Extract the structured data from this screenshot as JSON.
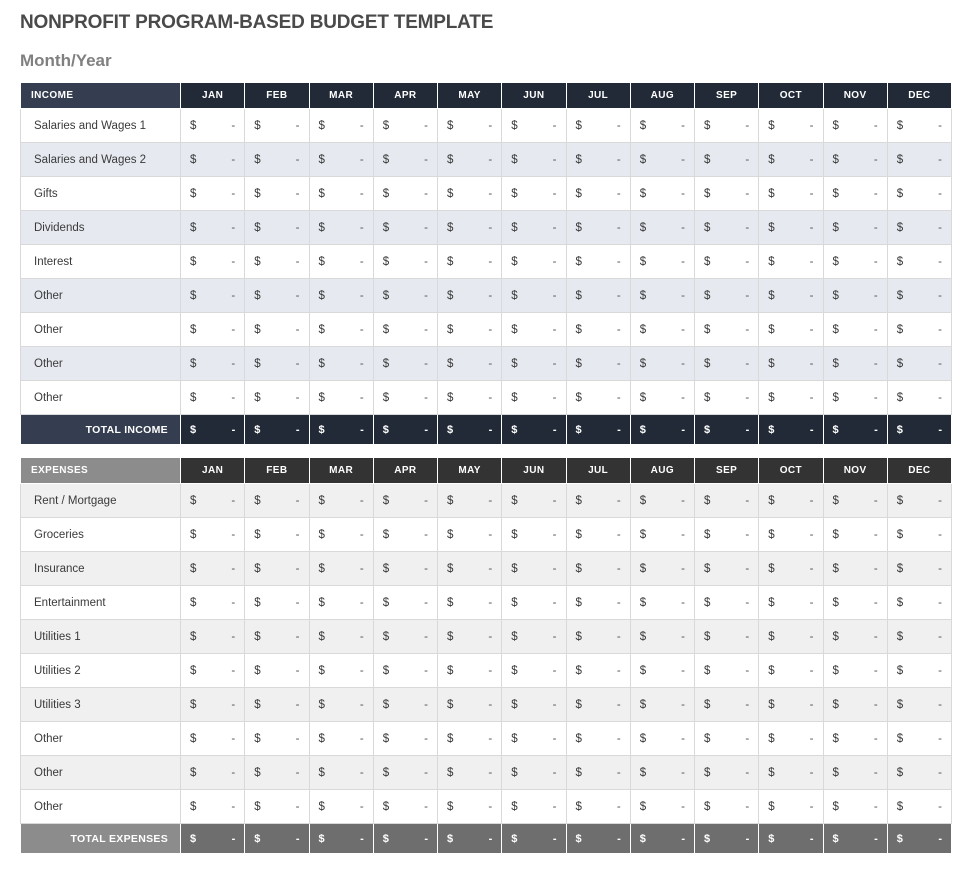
{
  "document": {
    "title": "NONPROFIT PROGRAM-BASED BUDGET TEMPLATE",
    "subtitle": "Month/Year"
  },
  "months": [
    "JAN",
    "FEB",
    "MAR",
    "APR",
    "MAY",
    "JUN",
    "JUL",
    "AUG",
    "SEP",
    "OCT",
    "NOV",
    "DEC"
  ],
  "cell": {
    "currency_symbol": "$",
    "empty_value": "-"
  },
  "colors": {
    "income_header": "#353e50",
    "income_header_month": "#222a38",
    "income_stripe": "#e6eaf0",
    "expenses_header": "#8c8c8c",
    "expenses_header_month": "#333333",
    "expenses_stripe": "#f0f0f0",
    "expenses_total_month": "#6e6e6e",
    "grid_line": "#d9d9d9",
    "title_text": "#4a4a4a",
    "subtitle_text": "#808080"
  },
  "income": {
    "header_label": "INCOME",
    "rows": [
      "Salaries and Wages 1",
      "Salaries and Wages 2",
      "Gifts",
      "Dividends",
      "Interest",
      "Other",
      "Other",
      "Other",
      "Other"
    ],
    "total_label": "TOTAL INCOME"
  },
  "expenses": {
    "header_label": "EXPENSES",
    "rows": [
      "Rent / Mortgage",
      "Groceries",
      "Insurance",
      "Entertainment",
      "Utilities 1",
      "Utilities 2",
      "Utilities 3",
      "Other",
      "Other",
      "Other"
    ],
    "total_label": "TOTAL EXPENSES"
  }
}
